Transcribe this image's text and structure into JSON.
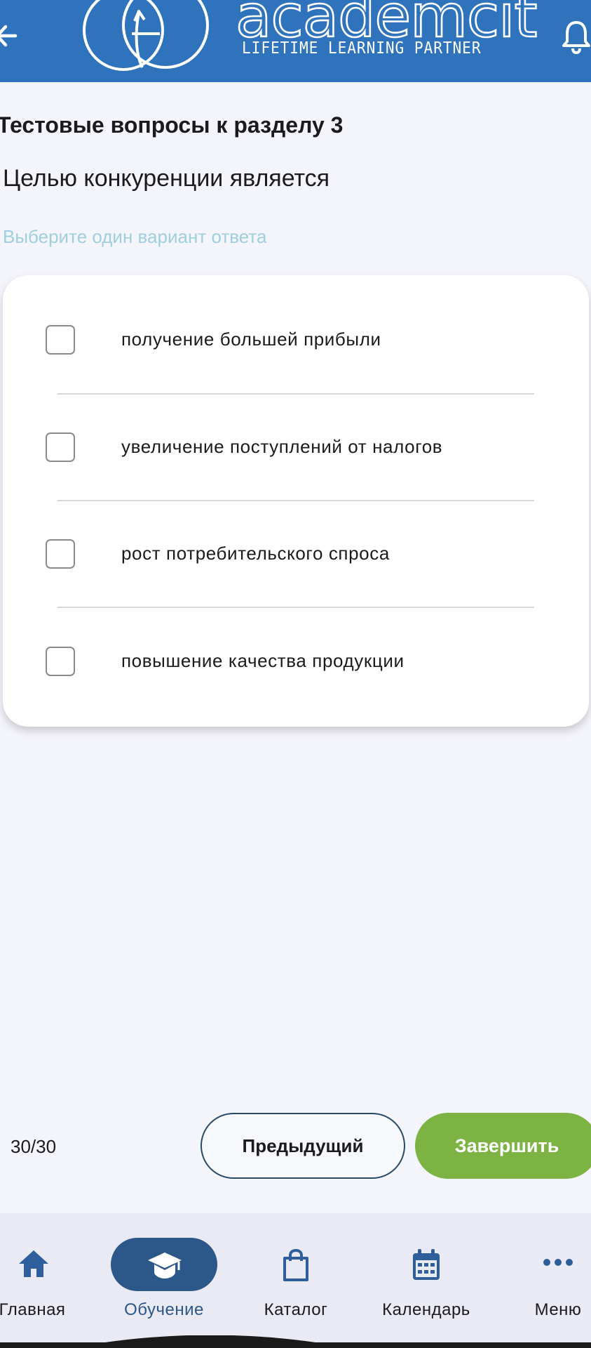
{
  "header": {
    "brand": "academcity",
    "tagline": "LIFETIME LEARNING PARTNER",
    "icons": [
      "back-arrow-icon",
      "logo-icon",
      "bell-icon"
    ],
    "color": "#2e73bb"
  },
  "quiz": {
    "section_title": "Тестовые вопросы к разделу 3",
    "question": "Целью конкуренции является",
    "hint": "Выберите один вариант ответа",
    "options": [
      {
        "label": "получение большей прибыли",
        "checked": false
      },
      {
        "label": "увеличение поступлений от налогов",
        "checked": false
      },
      {
        "label": "рост потребительского спроса",
        "checked": false
      },
      {
        "label": "повышение качества продукции",
        "checked": false
      }
    ]
  },
  "controls": {
    "counter": "30/30",
    "prev_label": "Предыдущий",
    "finish_label": "Завершить",
    "finish_color": "#7cb342"
  },
  "nav": {
    "active": "Обучение",
    "active_color": "#2b5789",
    "items": [
      {
        "label": "Главная",
        "icon": "home-icon"
      },
      {
        "label": "Обучение",
        "icon": "graduation-cap-icon"
      },
      {
        "label": "Каталог",
        "icon": "shopping-bag-icon"
      },
      {
        "label": "Календарь",
        "icon": "calendar-icon"
      },
      {
        "label": "Меню",
        "icon": "more-dots-icon"
      }
    ]
  }
}
